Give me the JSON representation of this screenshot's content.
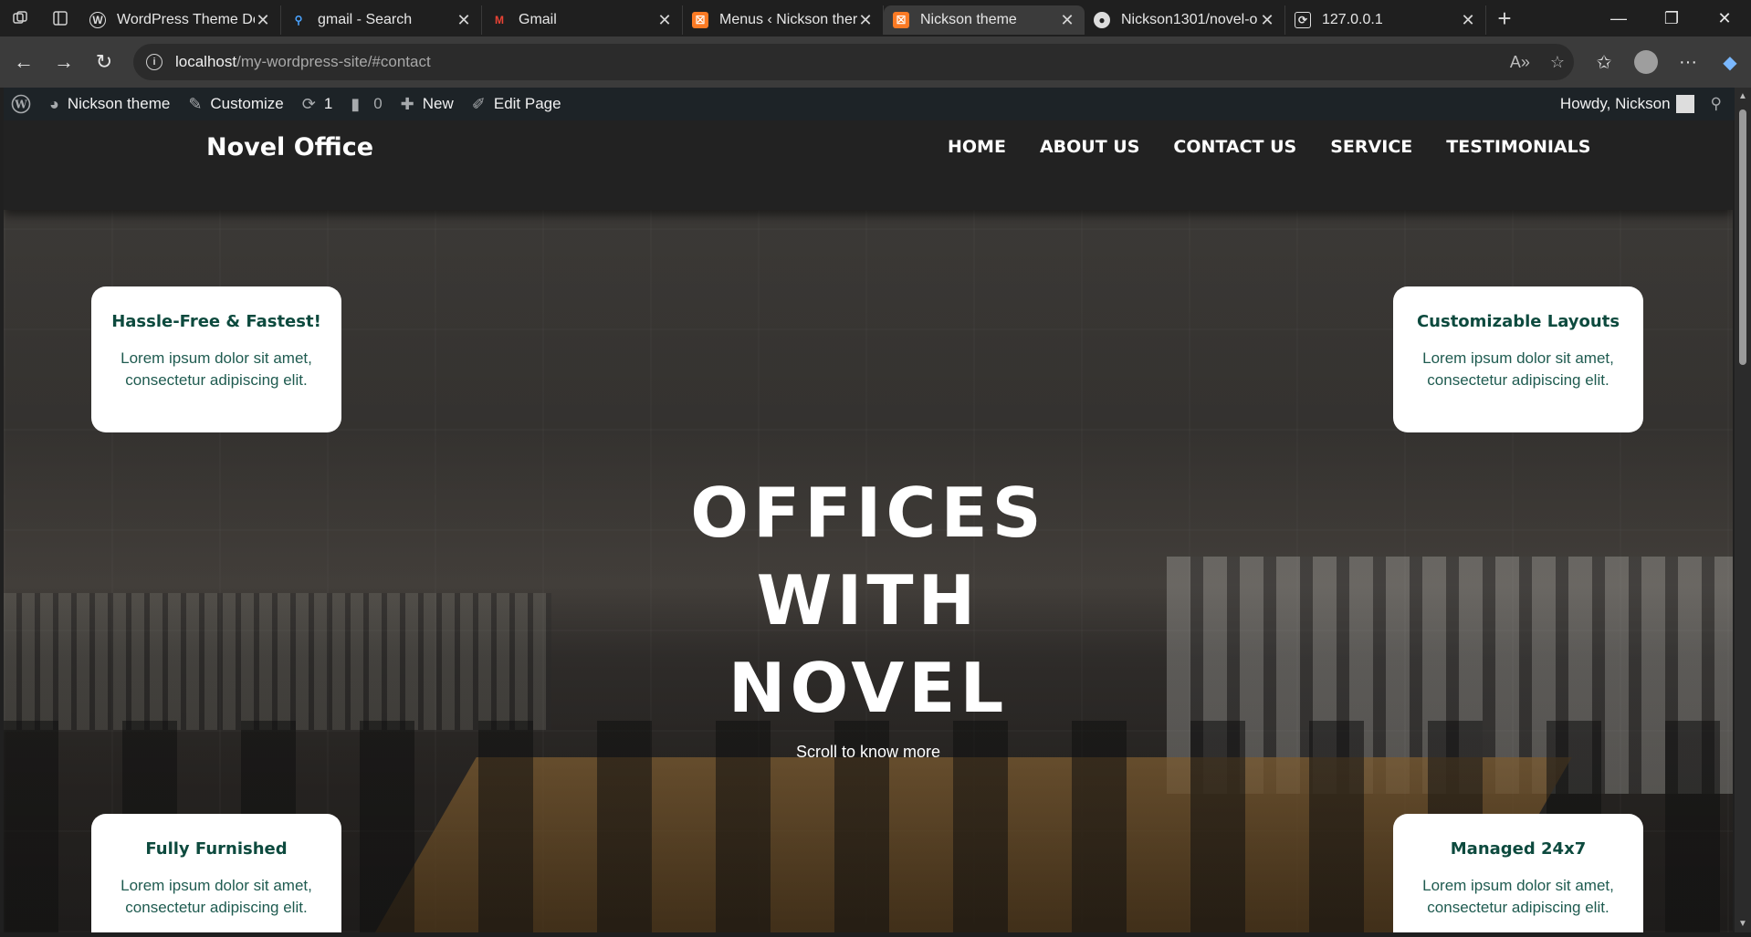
{
  "browser": {
    "tabs": [
      {
        "title": "WordPress Theme De",
        "icon": "wordpress-icon",
        "active": false
      },
      {
        "title": "gmail - Search",
        "icon": "search-icon",
        "active": false
      },
      {
        "title": "Gmail",
        "icon": "gmail-icon",
        "active": false
      },
      {
        "title": "Menus ‹ Nickson ther",
        "icon": "xampp-icon",
        "active": false
      },
      {
        "title": "Nickson theme",
        "icon": "xampp-icon",
        "active": true
      },
      {
        "title": "Nickson1301/novel-o",
        "icon": "github-icon",
        "active": false
      },
      {
        "title": "127.0.0.1",
        "icon": "document-icon",
        "active": false
      }
    ],
    "url_host": "localhost",
    "url_path": "/my-wordpress-site/#contact"
  },
  "adminbar": {
    "site_name": "Nickson theme",
    "customize": "Customize",
    "updates_count": "1",
    "comments_count": "0",
    "new_label": "New",
    "edit_label": "Edit Page",
    "howdy": "Howdy, Nickson"
  },
  "site": {
    "brand": "Novel Office",
    "menu": [
      "HOME",
      "ABOUT US",
      "CONTACT US",
      "SERVICE",
      "TESTIMONIALS"
    ],
    "headline": [
      "OFFICES",
      "WITH",
      "NOVEL"
    ],
    "scroll_text": "Scroll to know more",
    "cards": [
      {
        "title": "Hassle-Free & Fastest!",
        "text": "Lorem ipsum dolor sit amet, consectetur adipiscing elit."
      },
      {
        "title": "Customizable Layouts",
        "text": "Lorem ipsum dolor sit amet, consectetur adipiscing elit."
      },
      {
        "title": "Fully Furnished",
        "text": "Lorem ipsum dolor sit amet, consectetur adipiscing elit."
      },
      {
        "title": "Managed 24x7",
        "text": "Lorem ipsum dolor sit amet, consectetur adipiscing elit."
      }
    ]
  },
  "colors": {
    "card_title": "#0d4a3e",
    "header_bg": "#222222",
    "adminbar_bg": "#1d2327"
  }
}
